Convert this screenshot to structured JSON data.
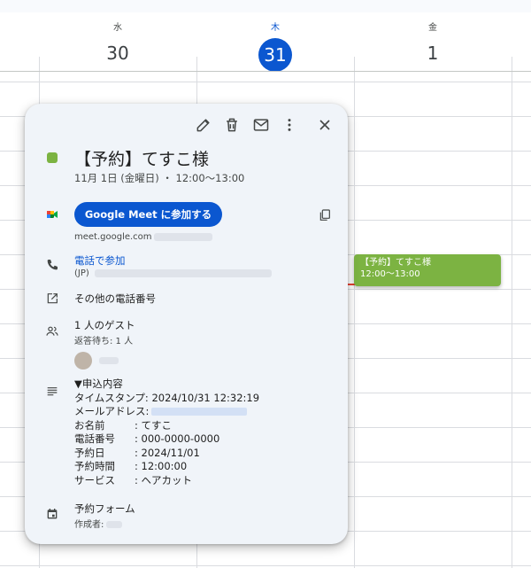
{
  "calendar": {
    "days": [
      {
        "dow": "水",
        "num": "30",
        "today": false
      },
      {
        "dow": "木",
        "num": "31",
        "today": true
      },
      {
        "dow": "金",
        "num": "1",
        "today": false
      }
    ]
  },
  "event_chip": {
    "title": "【予約】てすこ様",
    "time": "12:00～13:00",
    "color": "#7cb342"
  },
  "popup": {
    "toolbar": {
      "edit_icon": "pencil-icon",
      "delete_icon": "trash-icon",
      "email_icon": "mail-icon",
      "more_icon": "more-vert-icon",
      "close_icon": "close-icon"
    },
    "event_color": "#7cb342",
    "title": "【予約】てすこ様",
    "datetime": "11月 1日 (金曜日) ・ 12:00～13:00",
    "meet": {
      "button_label": "Google Meet に参加する",
      "link_prefix": "meet.google.com"
    },
    "phone": {
      "join_label": "電話で参加",
      "region": "(JP)"
    },
    "other_phones_label": "その他の電話番号",
    "guests": {
      "count_label": "1 人のゲスト",
      "pending_label": "返答待ち: 1 人"
    },
    "description": {
      "header": "▼申込内容",
      "timestamp": "タイムスタンプ: 2024/10/31 12:32:19",
      "email_label": "メールアドレス:",
      "rows": [
        {
          "label": "お名前",
          "value": ": てすこ"
        },
        {
          "label": "電話番号",
          "value": ": 000-0000-0000"
        },
        {
          "label": "予約日",
          "value": ": 2024/11/01"
        },
        {
          "label": "予約時間",
          "value": ": 12:00:00"
        },
        {
          "label": "サービス",
          "value": ": ヘアカット"
        }
      ]
    },
    "form": {
      "name": "予約フォーム",
      "creator_label": "作成者:"
    }
  }
}
